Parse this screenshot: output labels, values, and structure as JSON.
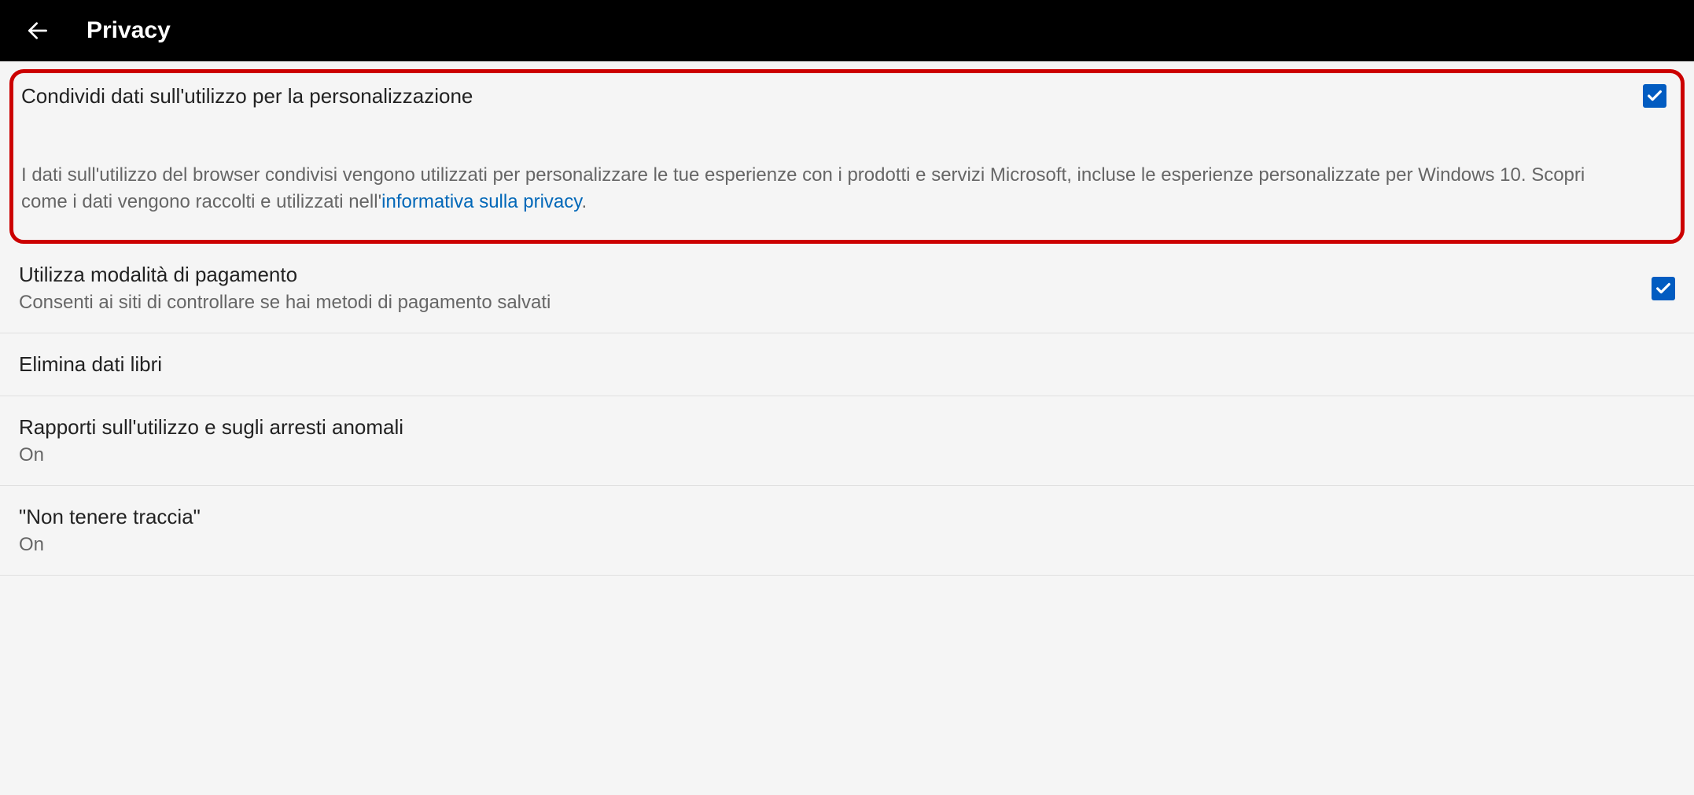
{
  "header": {
    "title": "Privacy"
  },
  "share_usage": {
    "title": "Condividi dati sull'utilizzo per la personalizzazione",
    "description_part1": "I dati sull'utilizzo del browser condivisi vengono utilizzati per personalizzare le tue esperienze con i prodotti e servizi Microsoft, incluse le esperienze personalizzate per Windows 10. Scopri come i dati vengono raccolti e utilizzati nell'",
    "link_text": "informativa sulla privacy",
    "description_part2": ".",
    "checked": true
  },
  "payment_mode": {
    "title": "Utilizza modalità di pagamento",
    "subtitle": "Consenti ai siti di controllare se hai metodi di pagamento salvati",
    "checked": true
  },
  "delete_books": {
    "title": "Elimina dati libri"
  },
  "usage_reports": {
    "title": "Rapporti sull'utilizzo e sugli arresti anomali",
    "subtitle": "On"
  },
  "do_not_track": {
    "title": "\"Non tenere traccia\"",
    "subtitle": "On"
  }
}
